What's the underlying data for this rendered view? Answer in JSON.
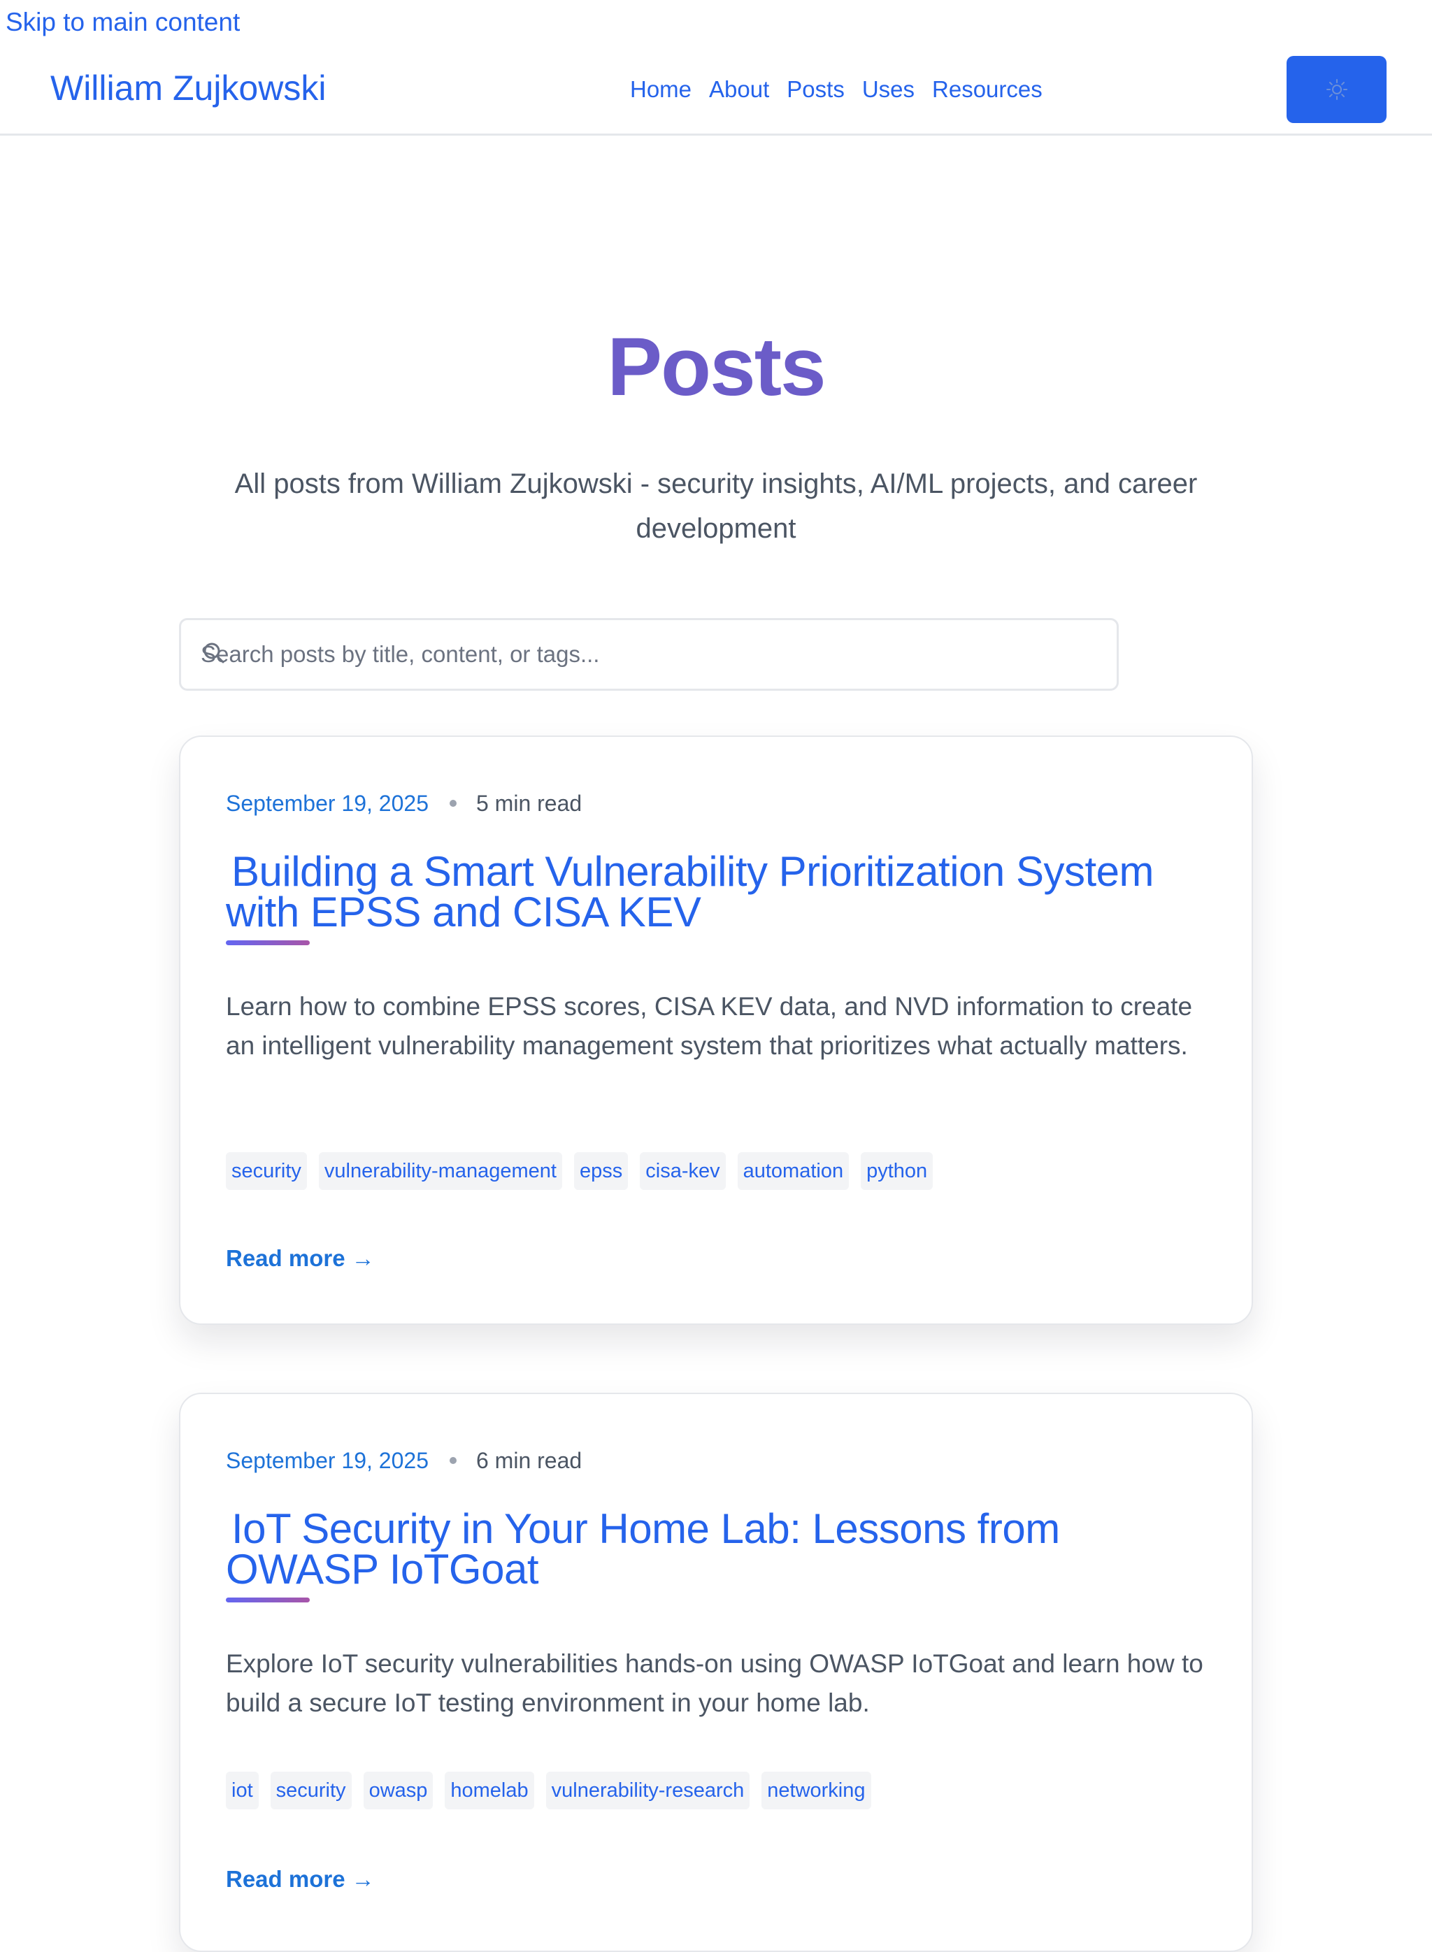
{
  "skip_link": "Skip to main content",
  "header": {
    "site_title": "William Zujkowski",
    "nav": [
      "Home",
      "About",
      "Posts",
      "Uses",
      "Resources"
    ],
    "theme_toggle_icon": "sun-icon",
    "accent_color": "#2563eb"
  },
  "main": {
    "title": "Posts",
    "title_color": "#6b5cc8",
    "subtitle": "All posts from William Zujkowski - security insights, AI/ML projects, and career development",
    "search": {
      "icon": "search-icon",
      "placeholder": "Search posts by title, content, or tags..."
    },
    "posts": [
      {
        "date": "September 19, 2025",
        "read_time": "5 min read",
        "title": "Building a Smart Vulnerability Prioritization System with EPSS and CISA KEV",
        "excerpt": "Learn how to combine EPSS scores, CISA KEV data, and NVD information to create an intelligent vulnerability management system that prioritizes what actually matters.",
        "tags": [
          "security",
          "vulnerability-management",
          "epss",
          "cisa-kev",
          "automation",
          "python"
        ],
        "read_more": "Read more →"
      },
      {
        "date": "September 19, 2025",
        "read_time": "6 min read",
        "title": "IoT Security in Your Home Lab: Lessons from OWASP IoTGoat",
        "excerpt": "Explore IoT security vulnerabilities hands-on using OWASP IoTGoat and learn how to build a secure IoT testing environment in your home lab.",
        "tags": [
          "iot",
          "security",
          "owasp",
          "homelab",
          "vulnerability-research",
          "networking"
        ],
        "read_more": "Read more →"
      }
    ]
  }
}
